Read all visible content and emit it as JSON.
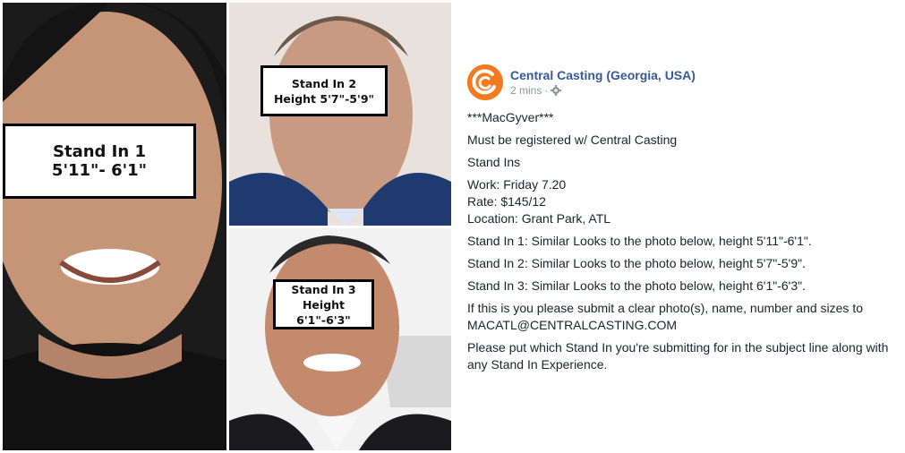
{
  "photos": {
    "stand_in_1": {
      "line1": "Stand In 1",
      "line2": "5'11\"- 6'1\""
    },
    "stand_in_2": {
      "line1": "Stand In 2",
      "line2": "Height 5'7\"-5'9\""
    },
    "stand_in_3": {
      "line1": "Stand In 3",
      "line2": "Height 6'1\"-6'3\""
    }
  },
  "post": {
    "page_name": "Central Casting (Georgia, USA)",
    "time": "2 mins",
    "logo_color": "#f47a20",
    "privacy_icon": "gear-icon",
    "lines": {
      "title": "***MacGyver***",
      "registered": "Must be registered w/ Central Casting",
      "stand_ins": "Stand Ins",
      "work": "Work: Friday 7.20",
      "rate": "Rate: $145/12",
      "location": "Location: Grant Park, ATL",
      "si1": "Stand In 1: Similar Looks to the photo below, height 5'11\"-6'1\".",
      "si2": "Stand In 2: Similar Looks to the photo below, height 5'7\"-5'9\".",
      "si3": "Stand In 3: Similar Looks to the photo below, height 6'1\"-6'3\".",
      "submit": "If this is you please submit a clear photo(s), name, number and sizes to MACATL@CENTRALCASTING.COM",
      "subject": "Please put which Stand In you're submitting for in the subject line along with any Stand In Experience."
    }
  }
}
